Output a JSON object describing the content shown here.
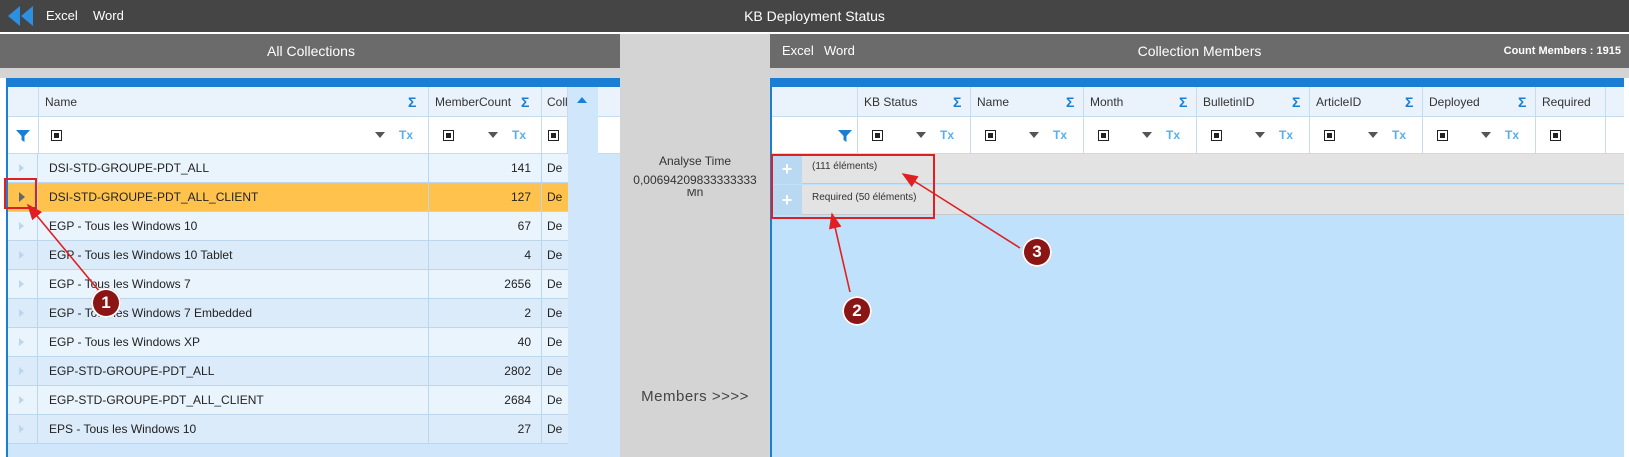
{
  "app": {
    "title": "KB Deployment Status",
    "menu": [
      "Excel",
      "Word"
    ]
  },
  "left_panel": {
    "title": "All Collections",
    "columns": [
      {
        "label": "Name",
        "sigma": "Σ"
      },
      {
        "label": "MemberCount",
        "sigma": "Σ"
      },
      {
        "label": "Coll"
      }
    ],
    "rows": [
      {
        "name": "DSI-STD-GROUPE-PDT_ALL",
        "count": "141",
        "coll": "De",
        "selected": false
      },
      {
        "name": "DSI-STD-GROUPE-PDT_ALL_CLIENT",
        "count": "127",
        "coll": "De",
        "selected": true
      },
      {
        "name": "EGP - Tous les Windows 10",
        "count": "67",
        "coll": "De",
        "selected": false
      },
      {
        "name": "EGP - Tous les Windows 10 Tablet",
        "count": "4",
        "coll": "De",
        "selected": false
      },
      {
        "name": "EGP - Tous les Windows 7",
        "count": "2656",
        "coll": "De",
        "selected": false
      },
      {
        "name": "EGP - Tous les Windows 7 Embedded",
        "count": "2",
        "coll": "De",
        "selected": false
      },
      {
        "name": "EGP - Tous les Windows XP",
        "count": "40",
        "coll": "De",
        "selected": false
      },
      {
        "name": "EGP-STD-GROUPE-PDT_ALL",
        "count": "2802",
        "coll": "De",
        "selected": false
      },
      {
        "name": "EGP-STD-GROUPE-PDT_ALL_CLIENT",
        "count": "2684",
        "coll": "De",
        "selected": false
      },
      {
        "name": "EPS - Tous les Windows 10",
        "count": "27",
        "coll": "De",
        "selected": false
      }
    ]
  },
  "middle": {
    "analyse_label": "Analyse Time",
    "analyse_value": "0,00694209833333333",
    "analyse_unit": "Mn",
    "members_button": "Members >>>>"
  },
  "right_panel": {
    "menu": [
      "Excel",
      "Word"
    ],
    "title": "Collection Members",
    "count_label": "Count Members : 1915",
    "columns": [
      {
        "label": "KB Status",
        "sigma": "Σ"
      },
      {
        "label": "Name",
        "sigma": "Σ"
      },
      {
        "label": "Month",
        "sigma": "Σ"
      },
      {
        "label": "BulletinID",
        "sigma": "Σ"
      },
      {
        "label": "ArticleID",
        "sigma": "Σ"
      },
      {
        "label": "Deployed",
        "sigma": "Σ"
      },
      {
        "label": "Required"
      }
    ],
    "groups": [
      {
        "label": "(111 éléments)",
        "icon": "+"
      },
      {
        "label": "Required (50 éléments)",
        "icon": "+"
      }
    ]
  },
  "annotations": [
    "1",
    "2",
    "3"
  ],
  "colors": {
    "topbar": "#454545",
    "header": "#6b6b6b",
    "accent": "#1a7fd4",
    "selected_row": "#ffc34d",
    "annotation": "#e02020",
    "marker": "#8b1414"
  }
}
